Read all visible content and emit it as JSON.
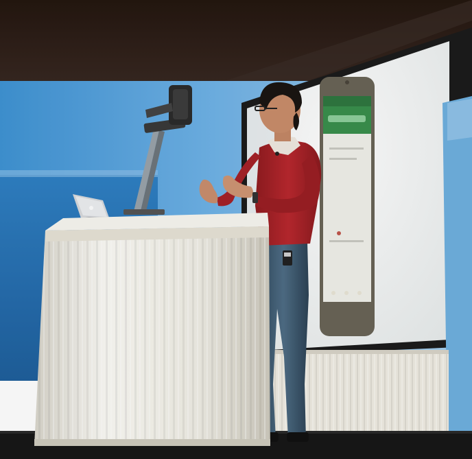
{
  "scene": {
    "kind": "photo",
    "colors": {
      "ceiling": "#2a1e1a",
      "wall_blue": "#3b8fd0",
      "screen": "#f7f7f4",
      "skirt": "#f3f1ea",
      "sweater": "#b2262b",
      "jeans": "#3d5a72",
      "floor": "#171717"
    }
  },
  "phone_mockup": {
    "header_color": "#3a8f4d",
    "body_color": "#f0f0ea",
    "frame_color": "#6a6457"
  }
}
